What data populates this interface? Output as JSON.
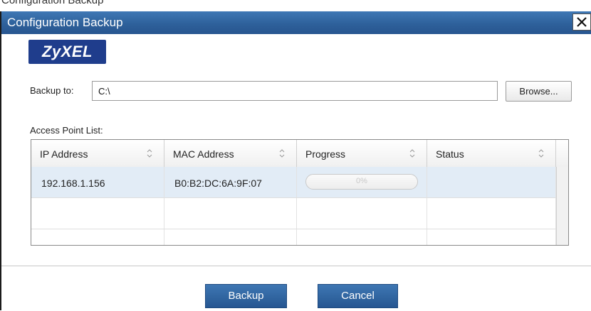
{
  "figure_caption_fragment": "Configuration Backup",
  "dialog": {
    "title": "Configuration Backup",
    "logo_text": "ZyXEL"
  },
  "backup": {
    "label": "Backup to:",
    "value": "C:\\",
    "browse_label": "Browse..."
  },
  "access_point_list": {
    "label": "Access Point List:",
    "columns": [
      "IP Address",
      "MAC Address",
      "Progress",
      "Status"
    ],
    "rows": [
      {
        "ip": "192.168.1.156",
        "mac": "B0:B2:DC:6A:9F:07",
        "progress_text": "0%",
        "progress_value": 0,
        "status": ""
      }
    ]
  },
  "footer": {
    "backup_label": "Backup",
    "cancel_label": "Cancel"
  },
  "colors": {
    "titlebar": "#2d5f99",
    "button": "#2f64a3",
    "selected_row": "#e2ecf6",
    "logo": "#1f3d8c"
  }
}
